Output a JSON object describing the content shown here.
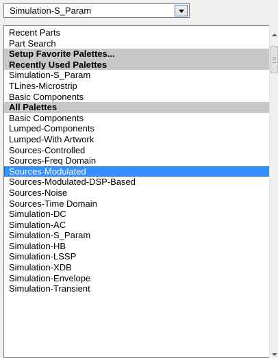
{
  "combo": {
    "selected_value": "Simulation-S_Param"
  },
  "list": {
    "items": [
      {
        "label": "Recent Parts",
        "kind": "item"
      },
      {
        "label": "Part Search",
        "kind": "item"
      },
      {
        "label": "Setup Favorite Palettes...",
        "kind": "header"
      },
      {
        "label": "Recently Used Palettes",
        "kind": "header"
      },
      {
        "label": "Simulation-S_Param",
        "kind": "item"
      },
      {
        "label": "TLines-Microstrip",
        "kind": "item"
      },
      {
        "label": "Basic Components",
        "kind": "item"
      },
      {
        "label": "All Palettes",
        "kind": "header"
      },
      {
        "label": "Basic Components",
        "kind": "item"
      },
      {
        "label": "Lumped-Components",
        "kind": "item"
      },
      {
        "label": "Lumped-With Artwork",
        "kind": "item"
      },
      {
        "label": "Sources-Controlled",
        "kind": "item"
      },
      {
        "label": "Sources-Freq Domain",
        "kind": "item"
      },
      {
        "label": "Sources-Modulated",
        "kind": "selected"
      },
      {
        "label": "Sources-Modulated-DSP-Based",
        "kind": "item"
      },
      {
        "label": "Sources-Noise",
        "kind": "item"
      },
      {
        "label": "Sources-Time Domain",
        "kind": "item"
      },
      {
        "label": "Simulation-DC",
        "kind": "item"
      },
      {
        "label": "Simulation-AC",
        "kind": "item"
      },
      {
        "label": "Simulation-S_Param",
        "kind": "item"
      },
      {
        "label": "Simulation-HB",
        "kind": "item"
      },
      {
        "label": "Simulation-LSSP",
        "kind": "item"
      },
      {
        "label": "Simulation-XDB",
        "kind": "item"
      },
      {
        "label": "Simulation-Envelope",
        "kind": "item"
      },
      {
        "label": "Simulation-Transient",
        "kind": "item"
      }
    ]
  },
  "colors": {
    "selection": "#3390ff",
    "header_bg": "#c8c8c8"
  }
}
